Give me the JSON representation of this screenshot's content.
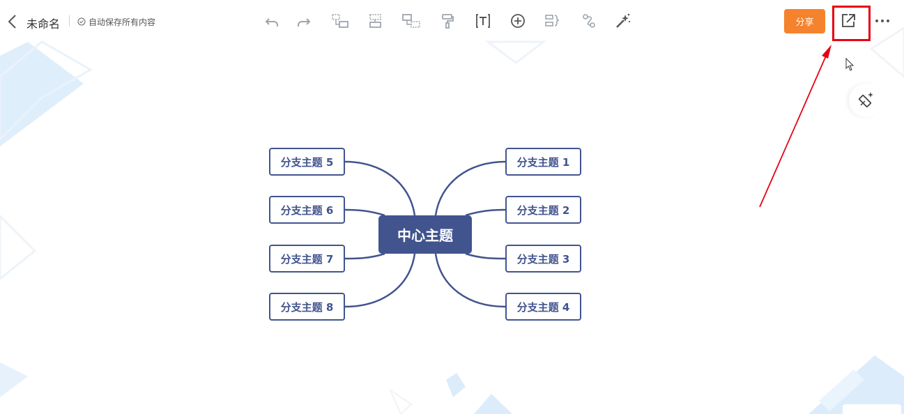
{
  "header": {
    "doc_title": "未命名",
    "save_status": "自动保存所有内容",
    "share_label": "分享"
  },
  "toolbar": {
    "tools": [
      "undo-icon",
      "redo-icon",
      "add-child-topic-icon",
      "add-sibling-topic-icon",
      "add-parent-topic-icon",
      "format-painter-icon",
      "text-icon",
      "insert-icon",
      "summary-icon",
      "relationship-icon",
      "magic-wand-icon"
    ]
  },
  "mindmap": {
    "center": "中心主题",
    "left_branches": [
      "分支主题 5",
      "分支主题 6",
      "分支主题 7",
      "分支主题 8"
    ],
    "right_branches": [
      "分支主题 1",
      "分支主题 2",
      "分支主题 3",
      "分支主题 4"
    ]
  },
  "colors": {
    "primary": "#42548e",
    "share_button": "#f5822c",
    "annotation": "#e60012",
    "background_decor": "#dcecfb"
  }
}
